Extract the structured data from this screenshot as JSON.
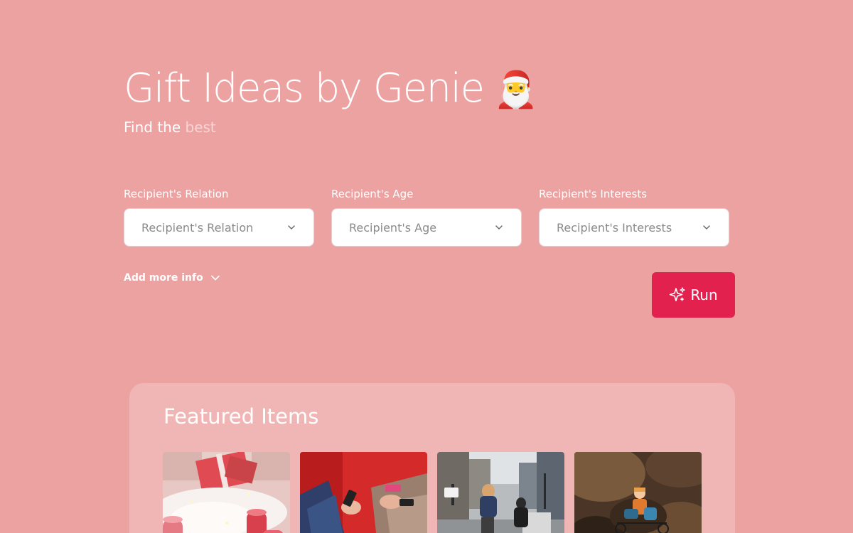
{
  "header": {
    "title": "Gift Ideas by Genie",
    "title_emoji": "🎅",
    "subtitle_prefix": "Find the",
    "subtitle_accent": "best"
  },
  "form": {
    "fields": [
      {
        "label": "Recipient's Relation",
        "placeholder": "Recipient's Relation"
      },
      {
        "label": "Recipient's Age",
        "placeholder": "Recipient's Age"
      },
      {
        "label": "Recipient's Interests",
        "placeholder": "Recipient's Interests"
      }
    ],
    "more_info_label": "Add more info",
    "run_label": "Run"
  },
  "featured": {
    "title": "Featured Items",
    "items": [
      {
        "image": "christmas-candles-gift-photo"
      },
      {
        "image": "friends-with-phones-photo"
      },
      {
        "image": "city-street-cyclists-photo"
      },
      {
        "image": "toy-figurine-photo"
      }
    ]
  },
  "colors": {
    "background": "#eda2a2",
    "card": "#f0b5b5",
    "accent": "#e3214f",
    "subtitle_accent": "#f7d5d5"
  },
  "icons": {
    "select_chevron": "chevron-down-icon",
    "more_info_chevron": "chevron-down-icon",
    "run": "sparkles-icon",
    "title": "santa-emoji"
  }
}
